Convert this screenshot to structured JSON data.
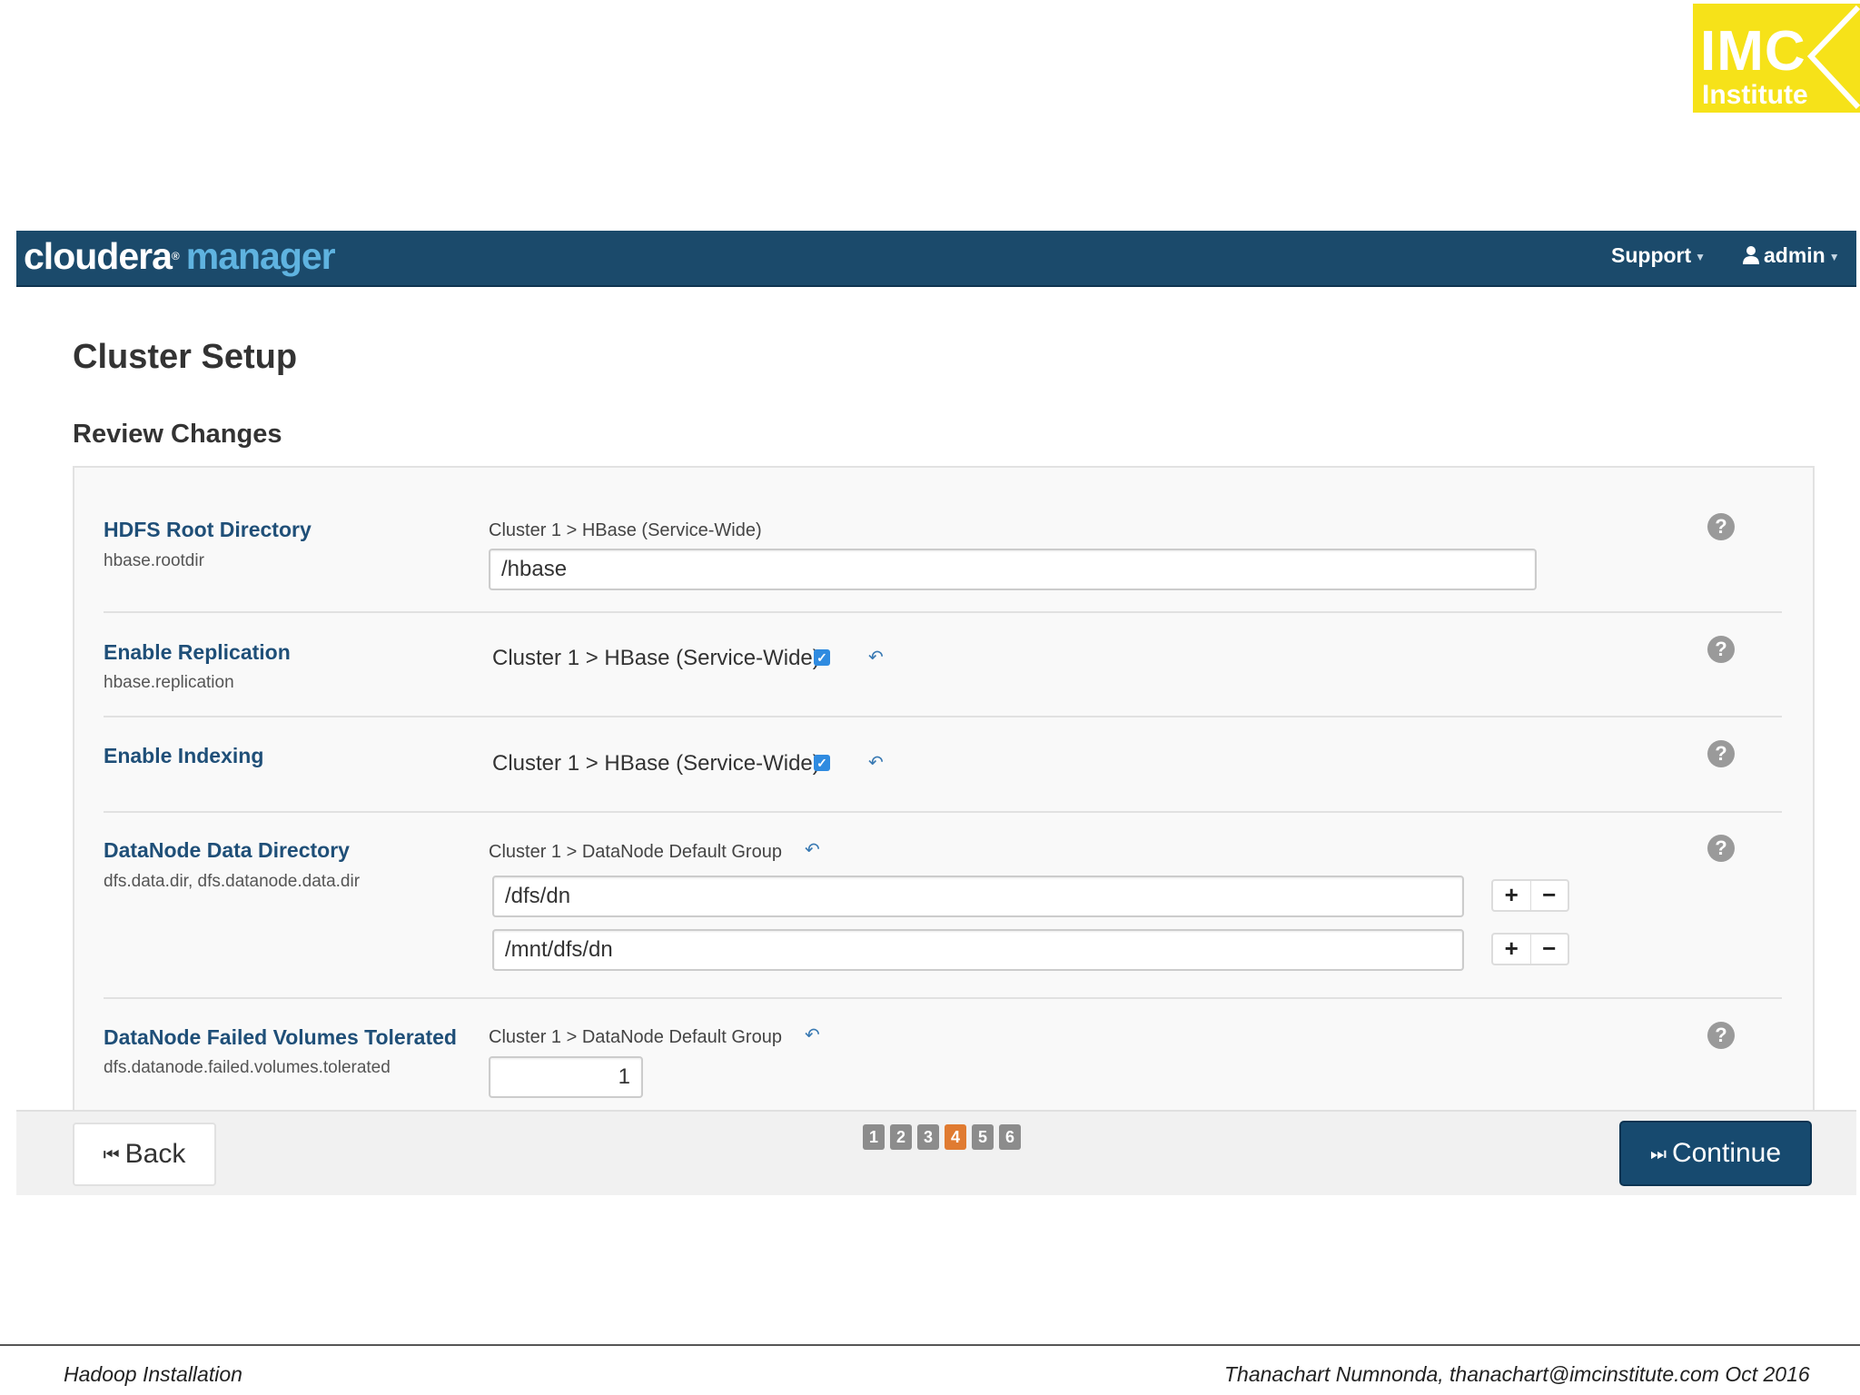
{
  "logo": {
    "line1": "IMC",
    "line2": "Institute"
  },
  "navbar": {
    "brand_main": "cloudera",
    "brand_sub": "manager",
    "support_label": "Support",
    "admin_label": "admin"
  },
  "page_title": "Cluster Setup",
  "section_title": "Review Changes",
  "properties": [
    {
      "name": "HDFS Root Directory",
      "key": "hbase.rootdir",
      "scope": "Cluster 1 > HBase (Service-Wide)",
      "value": "/hbase"
    },
    {
      "name": "Enable Replication",
      "key": "hbase.replication",
      "scope": "Cluster 1 > HBase (Service-Wide)",
      "checked": true
    },
    {
      "name": "Enable Indexing",
      "scope": "Cluster 1 > HBase (Service-Wide)",
      "checked": true
    },
    {
      "name": "DataNode Data Directory",
      "key": "dfs.data.dir, dfs.datanode.data.dir",
      "scope": "Cluster 1 > DataNode Default Group",
      "values": [
        "/dfs/dn",
        "/mnt/dfs/dn"
      ]
    },
    {
      "name": "DataNode Failed Volumes Tolerated",
      "key": "dfs.datanode.failed.volumes.tolerated",
      "scope": "Cluster 1 > DataNode Default Group",
      "value": "1"
    }
  ],
  "pager": {
    "pages": [
      "1",
      "2",
      "3",
      "4",
      "5",
      "6"
    ],
    "current": "4"
  },
  "buttons": {
    "back_label": "Back",
    "continue_label": "Continue"
  },
  "slide_footer": {
    "left": "Hadoop Installation",
    "right": "Thanachart Numnonda,  thanachart@imcinstitute.com  Oct 2016"
  },
  "colors": {
    "navbar": "#1b4a6b",
    "accent": "#e07b31",
    "link": "#1f4f78",
    "continue": "#174a6f"
  },
  "icons": [
    "user-icon",
    "help-icon",
    "undo-arrow-icon",
    "checkbox-icon",
    "plus-icon",
    "minus-icon",
    "skip-back-icon",
    "skip-forward-icon"
  ]
}
